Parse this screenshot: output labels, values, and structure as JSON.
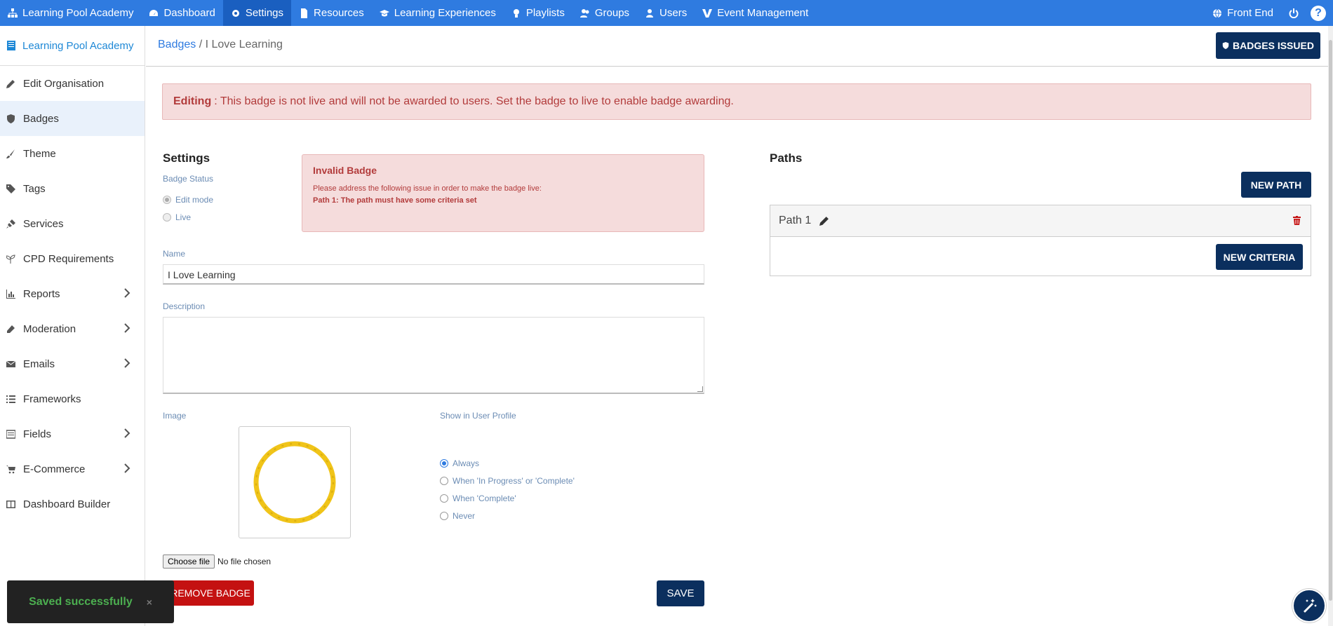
{
  "topnav": {
    "items": [
      {
        "label": "Learning Pool Academy",
        "icon": "sitemap-icon"
      },
      {
        "label": "Dashboard",
        "icon": "dashboard-icon"
      },
      {
        "label": "Settings",
        "icon": "gear-icon"
      },
      {
        "label": "Resources",
        "icon": "file-icon"
      },
      {
        "label": "Learning Experiences",
        "icon": "graduation-cap-icon"
      },
      {
        "label": "Playlists",
        "icon": "lightbulb-icon"
      },
      {
        "label": "Groups",
        "icon": "users-icon"
      },
      {
        "label": "Users",
        "icon": "user-icon"
      },
      {
        "label": "Event Management",
        "icon": "event-v-icon"
      }
    ],
    "front_end": "Front End",
    "help": "?",
    "active": "Settings"
  },
  "sidebar": {
    "org": "Learning Pool Academy",
    "items": [
      {
        "label": "Edit Organisation",
        "icon": "pencil-icon"
      },
      {
        "label": "Badges",
        "icon": "shield-icon"
      },
      {
        "label": "Theme",
        "icon": "brush-icon"
      },
      {
        "label": "Tags",
        "icon": "tags-icon"
      },
      {
        "label": "Services",
        "icon": "plug-icon"
      },
      {
        "label": "CPD Requirements",
        "icon": "seedling-icon"
      },
      {
        "label": "Reports",
        "icon": "chart-icon"
      },
      {
        "label": "Moderation",
        "icon": "eraser-icon"
      },
      {
        "label": "Emails",
        "icon": "envelope-icon"
      },
      {
        "label": "Frameworks",
        "icon": "list-icon"
      },
      {
        "label": "Fields",
        "icon": "form-icon"
      },
      {
        "label": "E-Commerce",
        "icon": "cart-icon"
      },
      {
        "label": "Dashboard Builder",
        "icon": "columns-icon"
      }
    ]
  },
  "breadcrumb": {
    "link": "Badges",
    "separator": " / ",
    "current": "I Love Learning"
  },
  "header": {
    "badges_issued": "BADGES ISSUED"
  },
  "alert": {
    "strong": "Editing",
    "text": ": This badge is not live and will not be awarded to users. Set the badge to live to enable badge awarding."
  },
  "settings": {
    "heading": "Settings",
    "badge_status_label": "Badge Status",
    "status_options": [
      "Edit mode",
      "Live"
    ],
    "name_label": "Name",
    "name_value": "I Love Learning",
    "description_label": "Description",
    "image_label": "Image",
    "show_label": "Show in User Profile",
    "show_options": [
      "Always",
      "When 'In Progress' or 'Complete'",
      "When 'Complete'",
      "Never"
    ],
    "choose_file": "Choose file",
    "no_file": "No file chosen",
    "remove": "REMOVE BADGE",
    "save": "SAVE"
  },
  "invalid": {
    "title": "Invalid Badge",
    "message": "Please address the following issue in order to make the badge live:",
    "issue": "Path 1: The path must have some criteria set"
  },
  "paths": {
    "heading": "Paths",
    "new_path": "NEW PATH",
    "path_name": "Path 1",
    "new_criteria": "NEW CRITERIA"
  },
  "toast": {
    "text": "Saved successfully",
    "close": "×"
  },
  "colors": {
    "nav": "#2f7be0",
    "dark_button": "#0b2f5e",
    "danger": "#c41111",
    "badge_ring": "#f0c419"
  }
}
